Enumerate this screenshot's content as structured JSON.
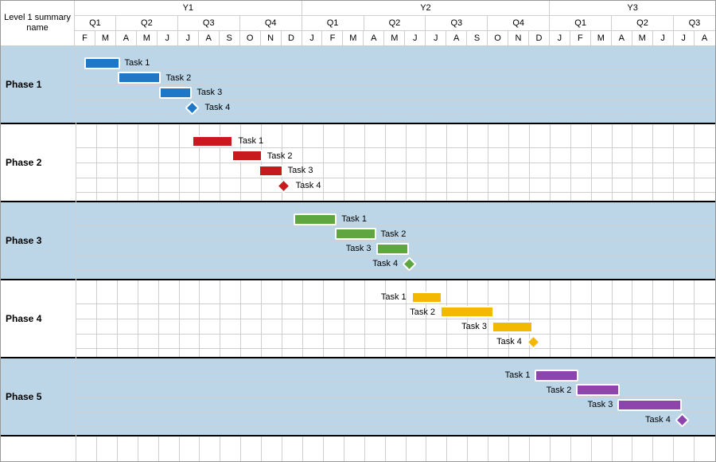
{
  "header": {
    "summary_label": "Level 1 summary name"
  },
  "months": [
    "F",
    "M",
    "A",
    "M",
    "J",
    "J",
    "A",
    "S",
    "O",
    "N",
    "D",
    "J",
    "F",
    "M",
    "A",
    "M",
    "J",
    "J",
    "A",
    "S",
    "O",
    "N",
    "D",
    "J",
    "F",
    "M",
    "A",
    "M",
    "J",
    "J",
    "A"
  ],
  "years": [
    {
      "label": "Y1",
      "span": 11
    },
    {
      "label": "Y2",
      "span": 12
    },
    {
      "label": "Y3",
      "span": 8
    }
  ],
  "quarters": [
    {
      "label": "Q1",
      "span": 2
    },
    {
      "label": "Q2",
      "span": 3
    },
    {
      "label": "Q3",
      "span": 3
    },
    {
      "label": "Q4",
      "span": 3
    },
    {
      "label": "Q1",
      "span": 3
    },
    {
      "label": "Q2",
      "span": 3
    },
    {
      "label": "Q3",
      "span": 3
    },
    {
      "label": "Q4",
      "span": 3
    },
    {
      "label": "Q1",
      "span": 3
    },
    {
      "label": "Q2",
      "span": 3
    },
    {
      "label": "Q3",
      "span": 2
    }
  ],
  "phases": [
    {
      "name": "Phase 1",
      "stripe": true,
      "color": "#1f77c8",
      "tasks": [
        {
          "label": "Task 1",
          "type": "bar",
          "start": 0.4,
          "end": 2.1,
          "label_side": "right"
        },
        {
          "label": "Task 2",
          "type": "bar",
          "start": 2.0,
          "end": 4.1,
          "label_side": "right"
        },
        {
          "label": "Task 3",
          "type": "bar",
          "start": 4.0,
          "end": 5.6,
          "label_side": "right"
        },
        {
          "label": "Task 4",
          "type": "milestone",
          "at": 5.6,
          "label_side": "right"
        }
      ]
    },
    {
      "name": "Phase 2",
      "stripe": false,
      "color": "#c8191e",
      "tasks": [
        {
          "label": "Task 1",
          "type": "bar",
          "start": 5.6,
          "end": 7.6,
          "label_side": "right"
        },
        {
          "label": "Task 2",
          "type": "bar",
          "start": 7.5,
          "end": 9.0,
          "label_side": "right"
        },
        {
          "label": "Task 3",
          "type": "bar",
          "start": 8.8,
          "end": 10.0,
          "label_side": "right"
        },
        {
          "label": "Task 4",
          "type": "milestone",
          "at": 10.0,
          "label_side": "right"
        }
      ]
    },
    {
      "name": "Phase 3",
      "stripe": true,
      "color": "#5fa641",
      "tasks": [
        {
          "label": "Task 1",
          "type": "bar",
          "start": 10.5,
          "end": 12.6,
          "label_side": "right"
        },
        {
          "label": "Task 2",
          "type": "bar",
          "start": 12.5,
          "end": 14.5,
          "label_side": "right"
        },
        {
          "label": "Task 3",
          "type": "bar",
          "start": 14.5,
          "end": 16.1,
          "label_side": "left"
        },
        {
          "label": "Task 4",
          "type": "milestone",
          "at": 16.1,
          "label_side": "left"
        }
      ]
    },
    {
      "name": "Phase 4",
      "stripe": false,
      "color": "#f2b900",
      "tasks": [
        {
          "label": "Task 1",
          "type": "bar",
          "start": 16.2,
          "end": 17.7,
          "label_side": "left"
        },
        {
          "label": "Task 2",
          "type": "bar",
          "start": 17.6,
          "end": 20.2,
          "label_side": "left"
        },
        {
          "label": "Task 3",
          "type": "bar",
          "start": 20.1,
          "end": 22.1,
          "label_side": "left"
        },
        {
          "label": "Task 4",
          "type": "milestone",
          "at": 22.1,
          "label_side": "left"
        }
      ]
    },
    {
      "name": "Phase 5",
      "stripe": true,
      "color": "#8e44ad",
      "tasks": [
        {
          "label": "Task 1",
          "type": "bar",
          "start": 22.2,
          "end": 24.3,
          "label_side": "left"
        },
        {
          "label": "Task 2",
          "type": "bar",
          "start": 24.2,
          "end": 26.3,
          "label_side": "left"
        },
        {
          "label": "Task 3",
          "type": "bar",
          "start": 26.2,
          "end": 29.3,
          "label_side": "left"
        },
        {
          "label": "Task 4",
          "type": "milestone",
          "at": 29.3,
          "label_side": "left"
        }
      ]
    }
  ],
  "chart_data": {
    "type": "bar",
    "title": "",
    "xlabel": "",
    "ylabel": "",
    "x_axis_months": [
      "Y1-Feb",
      "Y1-Mar",
      "Y1-Apr",
      "Y1-May",
      "Y1-Jun",
      "Y1-Jul",
      "Y1-Aug",
      "Y1-Sep",
      "Y1-Oct",
      "Y1-Nov",
      "Y1-Dec",
      "Y2-Jan",
      "Y2-Feb",
      "Y2-Mar",
      "Y2-Apr",
      "Y2-May",
      "Y2-Jun",
      "Y2-Jul",
      "Y2-Aug",
      "Y2-Sep",
      "Y2-Oct",
      "Y2-Nov",
      "Y2-Dec",
      "Y3-Jan",
      "Y3-Feb",
      "Y3-Mar",
      "Y3-Apr",
      "Y3-May",
      "Y3-Jun",
      "Y3-Jul",
      "Y3-Aug"
    ],
    "series": [
      {
        "name": "Phase 1 / Task 1",
        "start_month": 0.4,
        "end_month": 2.1
      },
      {
        "name": "Phase 1 / Task 2",
        "start_month": 2.0,
        "end_month": 4.1
      },
      {
        "name": "Phase 1 / Task 3",
        "start_month": 4.0,
        "end_month": 5.6
      },
      {
        "name": "Phase 1 / Task 4 (milestone)",
        "at_month": 5.6
      },
      {
        "name": "Phase 2 / Task 1",
        "start_month": 5.6,
        "end_month": 7.6
      },
      {
        "name": "Phase 2 / Task 2",
        "start_month": 7.5,
        "end_month": 9.0
      },
      {
        "name": "Phase 2 / Task 3",
        "start_month": 8.8,
        "end_month": 10.0
      },
      {
        "name": "Phase 2 / Task 4 (milestone)",
        "at_month": 10.0
      },
      {
        "name": "Phase 3 / Task 1",
        "start_month": 10.5,
        "end_month": 12.6
      },
      {
        "name": "Phase 3 / Task 2",
        "start_month": 12.5,
        "end_month": 14.5
      },
      {
        "name": "Phase 3 / Task 3",
        "start_month": 14.5,
        "end_month": 16.1
      },
      {
        "name": "Phase 3 / Task 4 (milestone)",
        "at_month": 16.1
      },
      {
        "name": "Phase 4 / Task 1",
        "start_month": 16.2,
        "end_month": 17.7
      },
      {
        "name": "Phase 4 / Task 2",
        "start_month": 17.6,
        "end_month": 20.2
      },
      {
        "name": "Phase 4 / Task 3",
        "start_month": 20.1,
        "end_month": 22.1
      },
      {
        "name": "Phase 4 / Task 4 (milestone)",
        "at_month": 22.1
      },
      {
        "name": "Phase 5 / Task 1",
        "start_month": 22.2,
        "end_month": 24.3
      },
      {
        "name": "Phase 5 / Task 2",
        "start_month": 24.2,
        "end_month": 26.3
      },
      {
        "name": "Phase 5 / Task 3",
        "start_month": 26.2,
        "end_month": 29.3
      },
      {
        "name": "Phase 5 / Task 4 (milestone)",
        "at_month": 29.3
      }
    ]
  }
}
